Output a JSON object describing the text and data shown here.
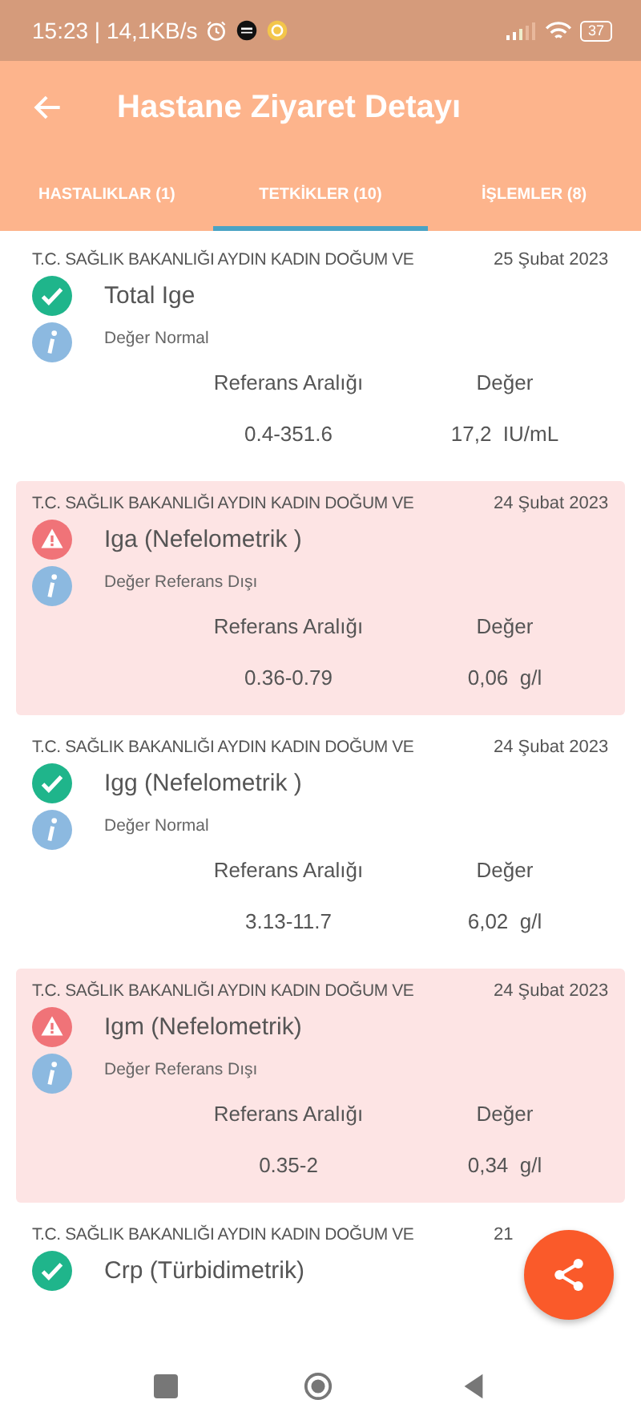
{
  "status_bar": {
    "time": "15:23 | 14,1KB/s",
    "battery": "37"
  },
  "app_bar": {
    "title": "Hastane Ziyaret Detayı"
  },
  "tabs": [
    {
      "label": "HASTALIKLAR (1)",
      "selected": false
    },
    {
      "label": "TETKİKLER (10)",
      "selected": true
    },
    {
      "label": "İŞLEMLER (8)",
      "selected": false
    }
  ],
  "tests": [
    {
      "hospital": "T.C. SAĞLIK BAKANLIĞI AYDIN KADIN DOĞUM VE",
      "date": "25 Şubat 2023",
      "name": "Total Ige",
      "kind": "normal",
      "note": "Değer Normal",
      "range_label": "Referans Aralığı",
      "value_label": "Değer",
      "range": "0.4-351.6",
      "value": "17,2  IU/mL"
    },
    {
      "hospital": "T.C. SAĞLIK BAKANLIĞI AYDIN KADIN DOĞUM VE",
      "date": "24 Şubat 2023",
      "name": "Iga (Nefelometrik )",
      "kind": "abnormal",
      "note": "Değer Referans Dışı",
      "range_label": "Referans Aralığı",
      "value_label": "Değer",
      "range": "0.36-0.79",
      "value": "0,06  g/l"
    },
    {
      "hospital": "T.C. SAĞLIK BAKANLIĞI AYDIN KADIN DOĞUM VE",
      "date": "24 Şubat 2023",
      "name": "Igg (Nefelometrik )",
      "kind": "normal",
      "note": "Değer Normal",
      "range_label": "Referans Aralığı",
      "value_label": "Değer",
      "range": "3.13-11.7",
      "value": "6,02  g/l"
    },
    {
      "hospital": "T.C. SAĞLIK BAKANLIĞI AYDIN KADIN DOĞUM VE",
      "date": "24 Şubat 2023",
      "name": "Igm (Nefelometrik)",
      "kind": "abnormal",
      "note": "Değer Referans Dışı",
      "range_label": "Referans Aralığı",
      "value_label": "Değer",
      "range": "0.35-2",
      "value": "0,34  g/l"
    },
    {
      "hospital": "T.C. SAĞLIK BAKANLIĞI AYDIN KADIN DOĞUM VE",
      "date": "21",
      "name": "Crp (Türbidimetrik)",
      "kind": "normal"
    }
  ]
}
